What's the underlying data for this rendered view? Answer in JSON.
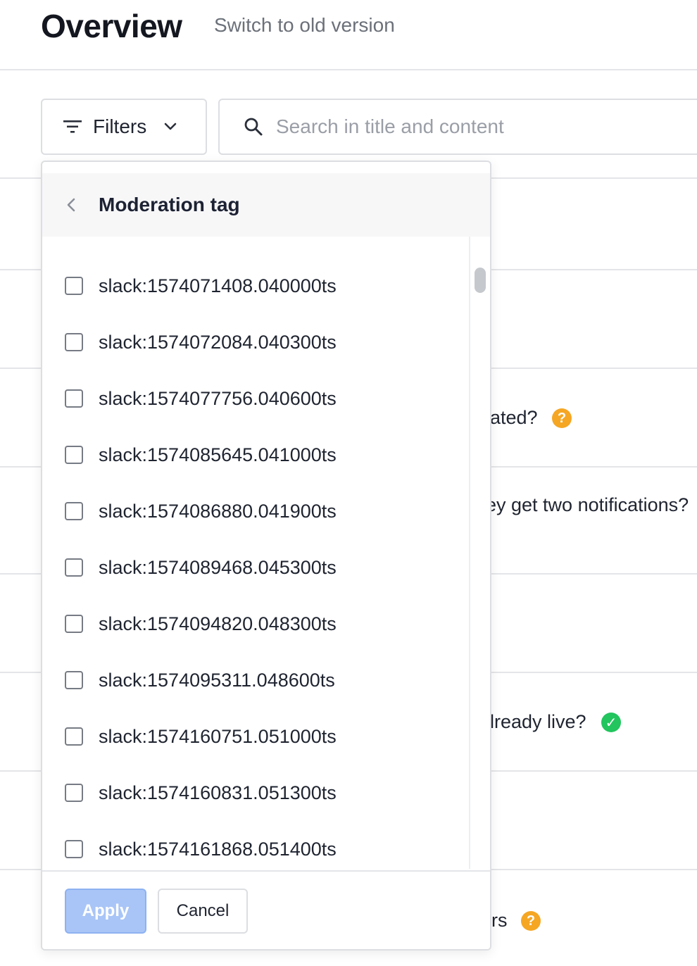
{
  "header": {
    "title": "Overview",
    "switch_link": "Switch to old version"
  },
  "toolbar": {
    "filters_label": "Filters",
    "search_placeholder": "Search in title and content"
  },
  "background_rows": [
    {
      "text": "",
      "badge": null
    },
    {
      "text": "",
      "badge": null
    },
    {
      "text": "ated?",
      "badge": "?"
    },
    {
      "text": "ey get two notifications?",
      "badge": null
    },
    {
      "text": "",
      "badge": null
    },
    {
      "text": "lready live?",
      "badge": "✓"
    },
    {
      "text": "",
      "badge": null
    },
    {
      "text": "rs",
      "badge": "?"
    }
  ],
  "dropdown": {
    "title": "Moderation tag",
    "options": [
      {
        "label": "slack:1574071408.040000ts",
        "checked": false
      },
      {
        "label": "slack:1574072084.040300ts",
        "checked": false
      },
      {
        "label": "slack:1574077756.040600ts",
        "checked": false
      },
      {
        "label": "slack:1574085645.041000ts",
        "checked": false
      },
      {
        "label": "slack:1574086880.041900ts",
        "checked": false
      },
      {
        "label": "slack:1574089468.045300ts",
        "checked": false
      },
      {
        "label": "slack:1574094820.048300ts",
        "checked": false
      },
      {
        "label": "slack:1574095311.048600ts",
        "checked": false
      },
      {
        "label": "slack:1574160751.051000ts",
        "checked": false
      },
      {
        "label": "slack:1574160831.051300ts",
        "checked": false
      },
      {
        "label": "slack:1574161868.051400ts",
        "checked": false
      }
    ],
    "apply_label": "Apply",
    "cancel_label": "Cancel"
  },
  "colors": {
    "accent_disabled": "#a9c5f7",
    "warning_badge": "#f5a623",
    "success_badge": "#22c55e"
  }
}
